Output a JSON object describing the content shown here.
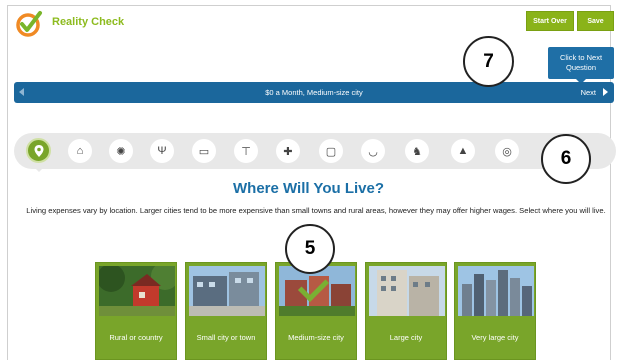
{
  "header": {
    "app_title": "Reality Check",
    "start_over_label": "Start Over",
    "save_label": "Save",
    "next_question_label": "Click to Next Question"
  },
  "status_bar": {
    "label": "$0 a Month, Medium-size city",
    "next_label": "Next"
  },
  "categories": [
    {
      "icon": "location-pin-icon",
      "glyph": "⚲",
      "active": true
    },
    {
      "icon": "home-icon",
      "glyph": "⌂"
    },
    {
      "icon": "utilities-bulb-icon",
      "glyph": "✺"
    },
    {
      "icon": "food-utensils-icon",
      "glyph": "Ψ"
    },
    {
      "icon": "car-icon",
      "glyph": "▭"
    },
    {
      "icon": "clothing-shirt-icon",
      "glyph": "⊤"
    },
    {
      "icon": "first-aid-kit-icon",
      "glyph": "✚"
    },
    {
      "icon": "tv-icon",
      "glyph": "▢"
    },
    {
      "icon": "bowl-icon",
      "glyph": "◡"
    },
    {
      "icon": "pet-icon",
      "glyph": "♞"
    },
    {
      "icon": "graduation-cap-icon",
      "glyph": "▲"
    },
    {
      "icon": "piggy-bank-icon",
      "glyph": "◎"
    }
  ],
  "main": {
    "heading": "Where Will You Live?",
    "description": "Living expenses vary by location. Larger cities tend to be more expensive than small towns and rural areas, however they may offer higher wages. Select where you will live."
  },
  "choices": [
    {
      "label": "Rural or country"
    },
    {
      "label": "Small city or town"
    },
    {
      "label": "Medium-size city",
      "selected": true
    },
    {
      "label": "Large city"
    },
    {
      "label": "Very large city"
    }
  ],
  "callouts": [
    "7",
    "6",
    "5"
  ],
  "colors": {
    "brand_green": "#8ab319",
    "primary_blue": "#1b679c",
    "heading_blue": "#1b6fa6"
  }
}
